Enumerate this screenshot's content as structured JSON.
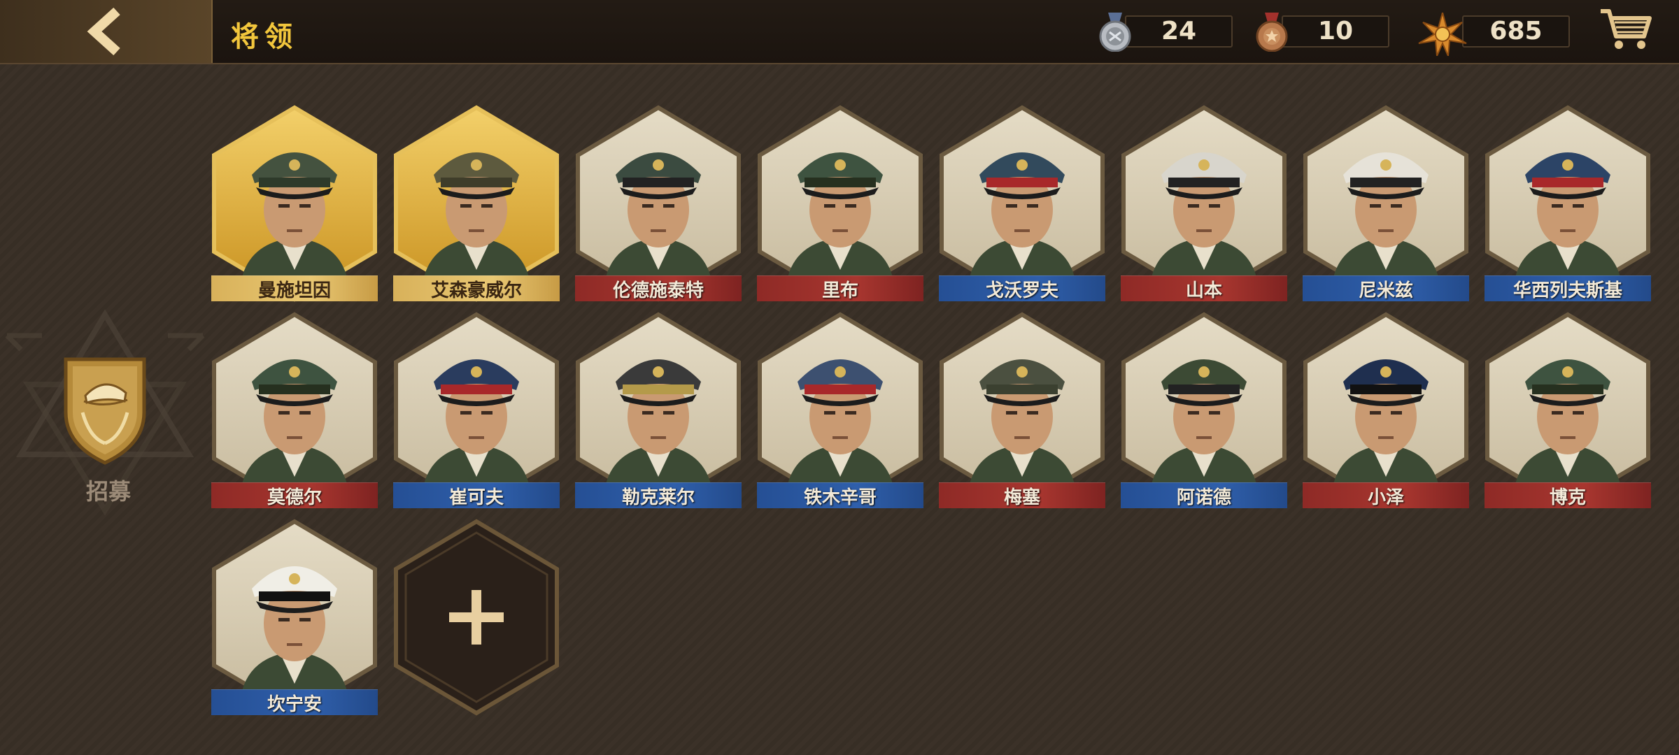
{
  "header": {
    "title": "将领"
  },
  "resources": [
    {
      "name": "silver-medal-icon",
      "value": "24"
    },
    {
      "name": "bronze-medal-icon",
      "value": "10"
    },
    {
      "name": "star-badge-icon",
      "value": "685"
    }
  ],
  "sidebar": {
    "recruit_label": "招募"
  },
  "generals": [
    {
      "name": "曼施坦因",
      "faction": "gold",
      "cap": "#44523f",
      "band": "#2e3a2a"
    },
    {
      "name": "艾森豪威尔",
      "faction": "gold",
      "cap": "#5d5a3e",
      "band": "#3f3d2a"
    },
    {
      "name": "伦德施泰特",
      "faction": "red",
      "cap": "#3b4b40",
      "band": "#222"
    },
    {
      "name": "里布",
      "faction": "red",
      "cap": "#3e5340",
      "band": "#26301f"
    },
    {
      "name": "戈沃罗夫",
      "faction": "blue",
      "cap": "#324a5c",
      "band": "#a8282a"
    },
    {
      "name": "山本",
      "faction": "red",
      "cap": "#d8d5cc",
      "band": "#222"
    },
    {
      "name": "尼米兹",
      "faction": "blue",
      "cap": "#e6e2d8",
      "band": "#222"
    },
    {
      "name": "华西列夫斯基",
      "faction": "blue",
      "cap": "#2c4466",
      "band": "#a8282a"
    },
    {
      "name": "莫德尔",
      "faction": "red",
      "cap": "#3e5340",
      "band": "#26301f"
    },
    {
      "name": "崔可夫",
      "faction": "blue",
      "cap": "#2a3c5e",
      "band": "#a8282a"
    },
    {
      "name": "勒克莱尔",
      "faction": "blue",
      "cap": "#3a3a3a",
      "band": "#b49a4a"
    },
    {
      "name": "铁木辛哥",
      "faction": "blue",
      "cap": "#3d5070",
      "band": "#a8282a"
    },
    {
      "name": "梅塞",
      "faction": "red",
      "cap": "#4b5040",
      "band": "#3b4030"
    },
    {
      "name": "阿诺德",
      "faction": "blue",
      "cap": "#3c4a34",
      "band": "#222"
    },
    {
      "name": "小泽",
      "faction": "red",
      "cap": "#1f2f4f",
      "band": "#111"
    },
    {
      "name": "博克",
      "faction": "red",
      "cap": "#3e5340",
      "band": "#26301f"
    },
    {
      "name": "坎宁安",
      "faction": "blue",
      "cap": "#f0eee6",
      "band": "#111"
    }
  ],
  "colors": {
    "accent": "#f2c63c",
    "red": "#a8362f",
    "blue": "#2f5fab",
    "gold": "#e0bd68"
  }
}
